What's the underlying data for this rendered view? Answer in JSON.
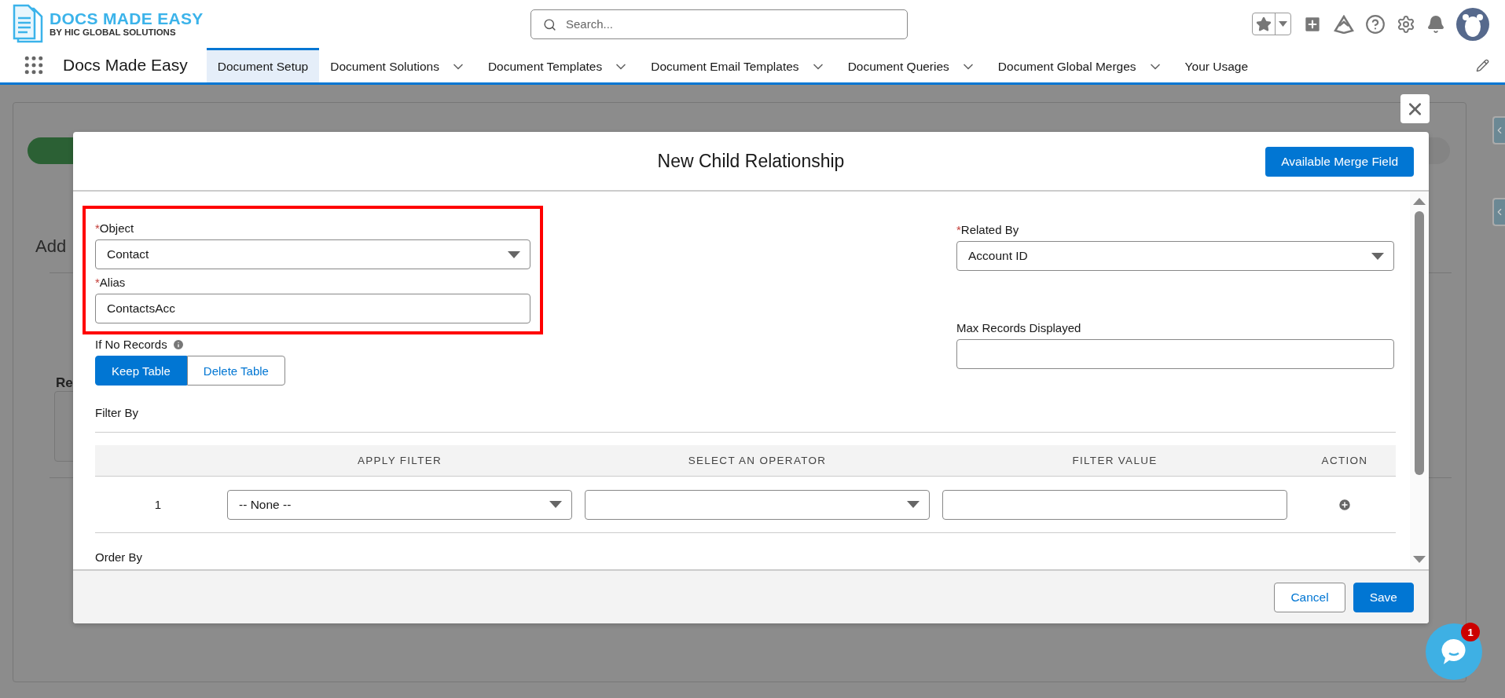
{
  "header": {
    "logo": {
      "title": "DOCS MADE EASY",
      "subtitle": "BY HIC GLOBAL SOLUTIONS"
    },
    "search": {
      "placeholder": "Search..."
    }
  },
  "nav": {
    "app_name": "Docs Made Easy",
    "tabs": [
      {
        "label": "Document Setup",
        "selected": true,
        "has_menu": false
      },
      {
        "label": "Document Solutions",
        "selected": false,
        "has_menu": true
      },
      {
        "label": "Document Templates",
        "selected": false,
        "has_menu": true
      },
      {
        "label": "Document Email Templates",
        "selected": false,
        "has_menu": true
      },
      {
        "label": "Document Queries",
        "selected": false,
        "has_menu": true
      },
      {
        "label": "Document Global Merges",
        "selected": false,
        "has_menu": true
      },
      {
        "label": "Your Usage",
        "selected": false,
        "has_menu": false
      }
    ]
  },
  "background": {
    "heading": "Add",
    "label": "Re"
  },
  "modal": {
    "title": "New Child Relationship",
    "merge_button": "Available Merge Field",
    "highlighted_fields": [
      {
        "kind": "select",
        "required_mark": "*",
        "label": "Object",
        "value": "Contact"
      },
      {
        "kind": "text",
        "required_mark": "*",
        "label": "Alias",
        "value": "ContactsAcc"
      }
    ],
    "right_fields": [
      {
        "kind": "select",
        "required_mark": "*",
        "label": "Related By",
        "value": "Account ID"
      },
      {
        "kind": "text",
        "label": "Max Records Displayed"
      }
    ],
    "if_no_records": {
      "label": "If No Records",
      "options": [
        {
          "label": "Keep Table",
          "selected": true
        },
        {
          "label": "Delete Table",
          "selected": false
        }
      ]
    },
    "filter_by": {
      "label": "Filter By",
      "columns": [
        "APPLY FILTER",
        "SELECT AN OPERATOR",
        "FILTER VALUE",
        "ACTION"
      ],
      "rows": [
        {
          "index": "1",
          "filter": "-- None --"
        }
      ]
    },
    "order_by": {
      "label": "Order By"
    },
    "buttons": {
      "cancel": "Cancel",
      "save": "Save"
    }
  },
  "chat": {
    "badge": "1"
  }
}
